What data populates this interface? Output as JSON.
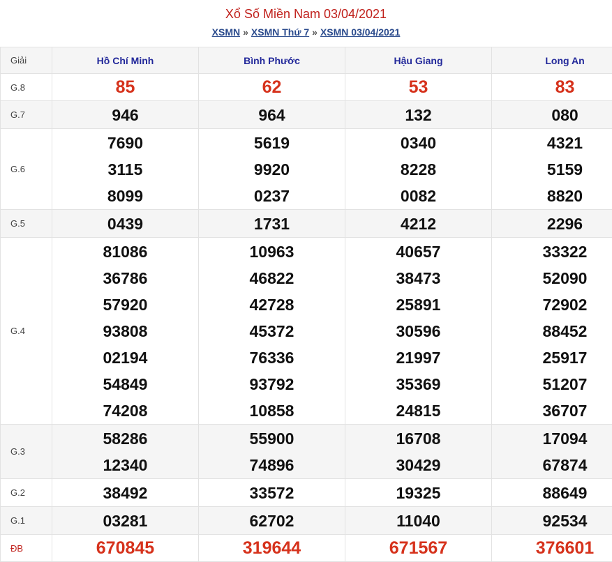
{
  "title": "Xổ Số Miền Nam 03/04/2021",
  "breadcrumb": [
    "XSMN",
    "XSMN Thứ 7",
    "XSMN 03/04/2021"
  ],
  "breadcrumb_sep": "»",
  "table": {
    "corner": "Giải",
    "provinces": [
      "Hồ Chí Minh",
      "Bình Phước",
      "Hậu Giang",
      "Long An"
    ],
    "rows": [
      {
        "label": "G.8",
        "values": [
          [
            "85"
          ],
          [
            "62"
          ],
          [
            "53"
          ],
          [
            "83"
          ]
        ]
      },
      {
        "label": "G.7",
        "values": [
          [
            "946"
          ],
          [
            "964"
          ],
          [
            "132"
          ],
          [
            "080"
          ]
        ]
      },
      {
        "label": "G.6",
        "values": [
          [
            "7690",
            "3115",
            "8099"
          ],
          [
            "5619",
            "9920",
            "0237"
          ],
          [
            "0340",
            "8228",
            "0082"
          ],
          [
            "4321",
            "5159",
            "8820"
          ]
        ]
      },
      {
        "label": "G.5",
        "values": [
          [
            "0439"
          ],
          [
            "1731"
          ],
          [
            "4212"
          ],
          [
            "2296"
          ]
        ]
      },
      {
        "label": "G.4",
        "values": [
          [
            "81086",
            "36786",
            "57920",
            "93808",
            "02194",
            "54849",
            "74208"
          ],
          [
            "10963",
            "46822",
            "42728",
            "45372",
            "76336",
            "93792",
            "10858"
          ],
          [
            "40657",
            "38473",
            "25891",
            "30596",
            "21997",
            "35369",
            "24815"
          ],
          [
            "33322",
            "52090",
            "72902",
            "88452",
            "25917",
            "51207",
            "36707"
          ]
        ]
      },
      {
        "label": "G.3",
        "values": [
          [
            "58286",
            "12340"
          ],
          [
            "55900",
            "74896"
          ],
          [
            "16708",
            "30429"
          ],
          [
            "17094",
            "67874"
          ]
        ]
      },
      {
        "label": "G.2",
        "values": [
          [
            "38492"
          ],
          [
            "33572"
          ],
          [
            "19325"
          ],
          [
            "88649"
          ]
        ]
      },
      {
        "label": "G.1",
        "values": [
          [
            "03281"
          ],
          [
            "62702"
          ],
          [
            "11040"
          ],
          [
            "92534"
          ]
        ]
      },
      {
        "label": "ĐB",
        "values": [
          [
            "670845"
          ],
          [
            "319644"
          ],
          [
            "671567"
          ],
          [
            "376601"
          ]
        ]
      }
    ]
  },
  "colors": {
    "title": "#c0211c",
    "link": "#2a4a8c",
    "province": "#22289a",
    "highlight": "#d6321c"
  }
}
